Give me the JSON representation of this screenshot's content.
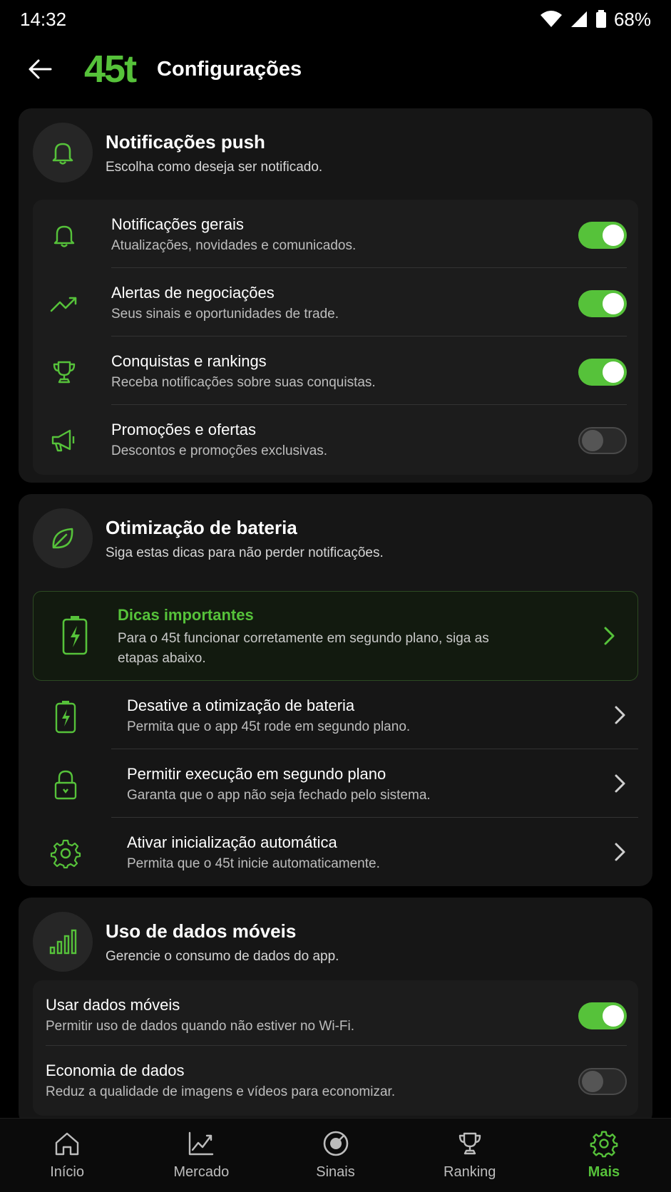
{
  "status_bar": {
    "time": "14:32",
    "battery": "68%"
  },
  "header": {
    "logo": "45t",
    "title": "Configurações"
  },
  "push_card": {
    "title": "Notificações push",
    "subtitle": "Escolha como deseja ser notificado.",
    "items": [
      {
        "title": "Notificações gerais",
        "subtitle": "Atualizações, novidades e comunicados.",
        "enabled": true
      },
      {
        "title": "Alertas de negociações",
        "subtitle": "Seus sinais e oportunidades de trade.",
        "enabled": true
      },
      {
        "title": "Conquistas e rankings",
        "subtitle": "Receba notificações sobre suas conquistas.",
        "enabled": true
      },
      {
        "title": "Promoções e ofertas",
        "subtitle": "Descontos e promoções exclusivas.",
        "enabled": false
      }
    ]
  },
  "battery_card": {
    "title": "Otimização de bateria",
    "subtitle": "Siga estas dicas para não perder notificações.",
    "tip": {
      "title": "Dicas importantes",
      "text": "Para o 45t funcionar corretamente em segundo plano, siga as etapas abaixo."
    },
    "items": [
      {
        "title": "Desative a otimização de bateria",
        "subtitle": "Permita que o app 45t rode em segundo plano."
      },
      {
        "title": "Permitir execução em segundo plano",
        "subtitle": "Garanta que o app não seja fechado pelo sistema."
      },
      {
        "title": "Ativar inicialização automática",
        "subtitle": "Permita que o 45t inicie automaticamente."
      }
    ]
  },
  "data_card": {
    "title": "Uso de dados móveis",
    "subtitle": "Gerencie o consumo de dados do app.",
    "items": [
      {
        "title": "Usar dados móveis",
        "subtitle": "Permitir uso de dados quando não estiver no Wi-Fi.",
        "enabled": true
      },
      {
        "title": "Economia de dados",
        "subtitle": "Reduz a qualidade de imagens e vídeos para economizar.",
        "enabled": false
      }
    ]
  },
  "nav": {
    "items": [
      {
        "label": "Início",
        "icon": "home-icon"
      },
      {
        "label": "Mercado",
        "icon": "chart-icon"
      },
      {
        "label": "Sinais",
        "icon": "target-icon"
      },
      {
        "label": "Ranking",
        "icon": "trophy-icon"
      },
      {
        "label": "Mais",
        "icon": "gear-icon"
      }
    ],
    "active": "Mais"
  },
  "colors": {
    "accent": "#56c23a",
    "background": "#000000",
    "card": "#161616"
  }
}
